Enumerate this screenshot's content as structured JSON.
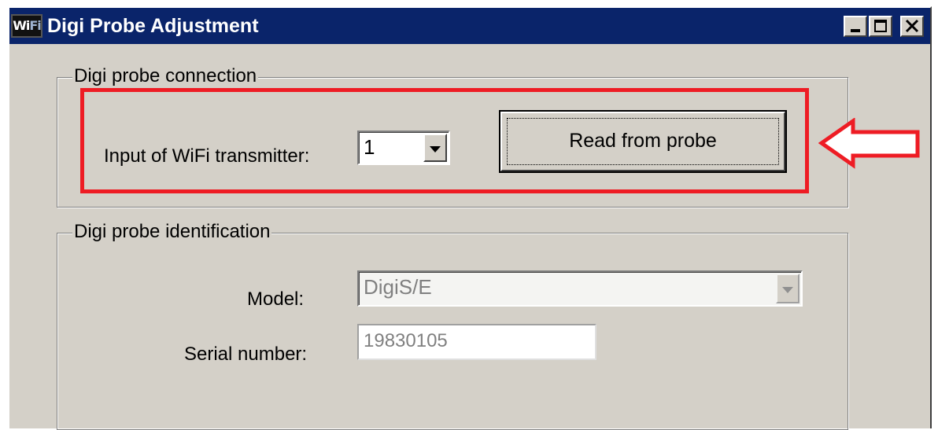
{
  "window": {
    "title": "Digi Probe Adjustment",
    "icon_text": "Wi",
    "icon_text2": "Fi"
  },
  "connection": {
    "group_label": "Digi probe connection",
    "input_label": "Input of WiFi transmitter:",
    "input_value": "1",
    "read_button": "Read from probe"
  },
  "identification": {
    "group_label": "Digi probe identification",
    "model_label": "Model:",
    "model_value": "DigiS/E",
    "serial_label": "Serial number:",
    "serial_value": "19830105"
  },
  "annotation": {
    "highlight_color": "#ee1c24",
    "arrow_icon": "left-arrow-icon"
  }
}
